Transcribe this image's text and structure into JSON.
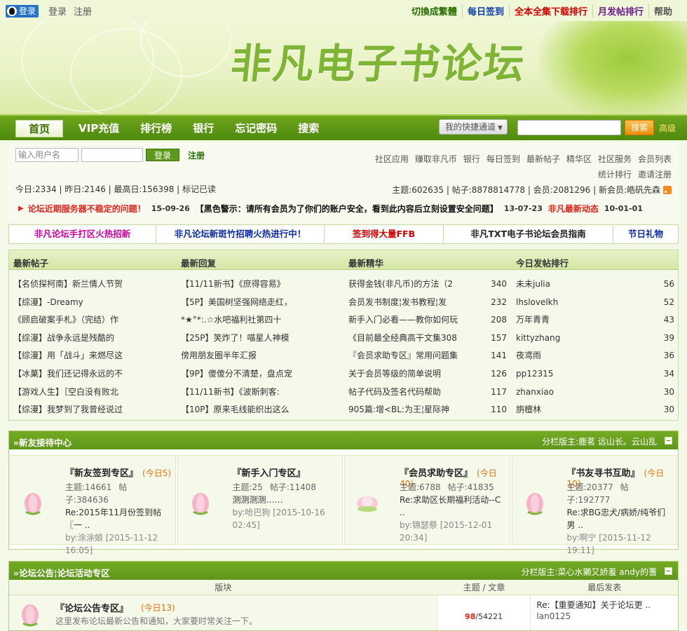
{
  "topbar": {
    "qq_login": "登录",
    "login": "登录",
    "register": "注册",
    "links": [
      {
        "label": "切換成繁體",
        "color": "#2a6e00"
      },
      {
        "label": "每日签到",
        "color": "#0b3ea8"
      },
      {
        "label": "全本全集下载排行",
        "color": "#d00000"
      },
      {
        "label": "月发帖排行",
        "color": "#6b1d8a"
      },
      {
        "label": "帮助",
        "color": "#555555"
      }
    ]
  },
  "banner": {
    "logo": "非凡电子书论坛"
  },
  "nav": {
    "items": [
      "首页",
      "VIP充值",
      "排行榜",
      "银行",
      "忘记密码",
      "搜索"
    ],
    "quick_select": "我的快捷通道",
    "search_btn": "搜索",
    "advanced": "高级"
  },
  "login": {
    "username_placeholder": "输入用户名",
    "login_btn": "登录",
    "register": "注册"
  },
  "quick_links": {
    "row1": [
      "社区应用",
      "赚取非凡币",
      "银行",
      "每日签到",
      "最新帖子",
      "精华区",
      "社区服务",
      "会员列表"
    ],
    "row2": [
      "统计排行",
      "邀请注册"
    ]
  },
  "stats": {
    "left": "今日:2334 | 昨日:2146 | 最高日:156398 | 标记已读",
    "right": "主题:602635 | 帖子:8878814778 | 会员:2081296 | 新会员:皓矾先森"
  },
  "ticker": {
    "t1": "论坛近期服务器不稳定的问题！",
    "d1": "15-09-26",
    "t2": "【黑色警示：请所有会员为了你们的账户安全，看到此内容后立刻设置安全问题】",
    "d2": "13-07-23",
    "t3": "非凡最新动态",
    "d3": "10-01-01"
  },
  "linkbar": [
    {
      "label": "非凡论坛手打区火热招新",
      "color": "#d0009a"
    },
    {
      "label": "非凡论坛新斑竹招聘火热进行中！",
      "color": "#0b2aa8"
    },
    {
      "label": "签到得大量FFB",
      "color": "#d00000"
    },
    {
      "label": "非凡TXT电子书论坛会员指南",
      "color": "#222222"
    },
    {
      "label": "节日礼物",
      "color": "#0b2aa8"
    }
  ],
  "stat_table": {
    "headers": [
      {
        "label": "最新帖子",
        "color": "#7a1f9a"
      },
      {
        "label": "最新回复",
        "color": "#333333"
      },
      {
        "label": "最新精华",
        "color": "#e8710a"
      },
      {
        "label": "今日发帖排行",
        "color": "#333333"
      }
    ],
    "new_posts": [
      "【名侦探柯南】新兰情人节贺",
      "【综漫】-Dreamy",
      "《顾启破案手札》（完结）作",
      "【综漫】战争永远是残酷的",
      "【综漫】用「战斗」来燃尽这",
      "【冰菓】我们还记得永远的不",
      "【游戏人生】［空白没有败北",
      "【综漫】我梦到了我曾经说过"
    ],
    "new_replies": [
      "【11/11新书】《庶得容易》",
      "【5P】美国树坚强网络走红，",
      "*★°*:.☆水吧福利社第四十",
      "【25P】笑炸了！喵星人神模",
      "傍用朋友圈半年汇报",
      "【9P】傻傻分不清楚，盘点宠",
      "【11/11新书】《波斯刺客:",
      "【10P】原来毛线能织出这么"
    ],
    "digest": [
      {
        "title": "获得金钱(非凡币)的方法（2",
        "num": "340"
      },
      {
        "title": "会员发书制度¦发书教程¦发",
        "num": "232"
      },
      {
        "title": "新手入门必看——教你如何玩",
        "num": "208"
      },
      {
        "title": "《目前最全经典高干文集308",
        "num": "157"
      },
      {
        "title": "『会员求助专区』常用问题集",
        "num": "141"
      },
      {
        "title": "关于会员等级的简单说明",
        "num": "126"
      },
      {
        "title": "帖子代码及签名代码帮助",
        "num": "117"
      },
      {
        "title": "905篇:增<BL:为王¦星际神",
        "num": "110"
      }
    ],
    "ranking": [
      {
        "name": "未未julia",
        "num": "56"
      },
      {
        "name": "lhslovelkh",
        "num": "52"
      },
      {
        "name": "万年青青",
        "num": "43"
      },
      {
        "name": "kittyzhang",
        "num": "39"
      },
      {
        "name": "夜鸢雨",
        "num": "36"
      },
      {
        "name": "pp12315",
        "num": "34"
      },
      {
        "name": "zhanxiao",
        "num": "30"
      },
      {
        "name": "旃檀林",
        "num": "30"
      }
    ]
  },
  "section1": {
    "title": "»新友接待中心",
    "mods": "分栏版主:鹿茗  远山长。云山乱",
    "forums": [
      {
        "name": "『新友签到专区』",
        "today": "(今日5)",
        "topics": "主题:14661",
        "posts": "帖子:384636",
        "last": "Re:2015年11月份签到帖〖一 ..",
        "by": "by:涂涂娘 [2015-11-12 16:05]"
      },
      {
        "name": "『新手入门专区』",
        "today": "",
        "topics": "主题:25",
        "posts": "帖子:11408",
        "last": "测测测测……",
        "by": "by:哈巴狗 [2015-10-16 02:45]"
      },
      {
        "name": "『会员求助专区』",
        "today": "(今日40)",
        "topics": "主题:6788",
        "posts": "帖子:41835",
        "last": "Re:求助区长期福利活动--C ..",
        "by": "by:锦瑟祭 [2015-12-01 20:34]"
      },
      {
        "name": "『书友寻书互助』",
        "today": "(今日10)",
        "topics": "主题:20377",
        "posts": "帖子:192777",
        "last": "Re:求BG忠犬/病娇/纯爷们男 ..",
        "by": "by:啊宁 [2015-11-12 19:11]"
      }
    ]
  },
  "section2": {
    "title": "»论坛公告¦论坛活动专区",
    "mods": "分栏版主:菜心水獭又娇羞  andy的蓍",
    "headers": [
      "版块",
      "主题 / 文章",
      "最后发表"
    ],
    "forum": {
      "name": "『论坛公告专区』",
      "today": "(今日13)",
      "desc": "这里发布论坛最新公告和通知，大家要时常关注一下。",
      "topics": "98",
      "posts": "54221",
      "last": "Re:【重要通知】关于论坛更 ..",
      "by": "lan0125"
    }
  }
}
